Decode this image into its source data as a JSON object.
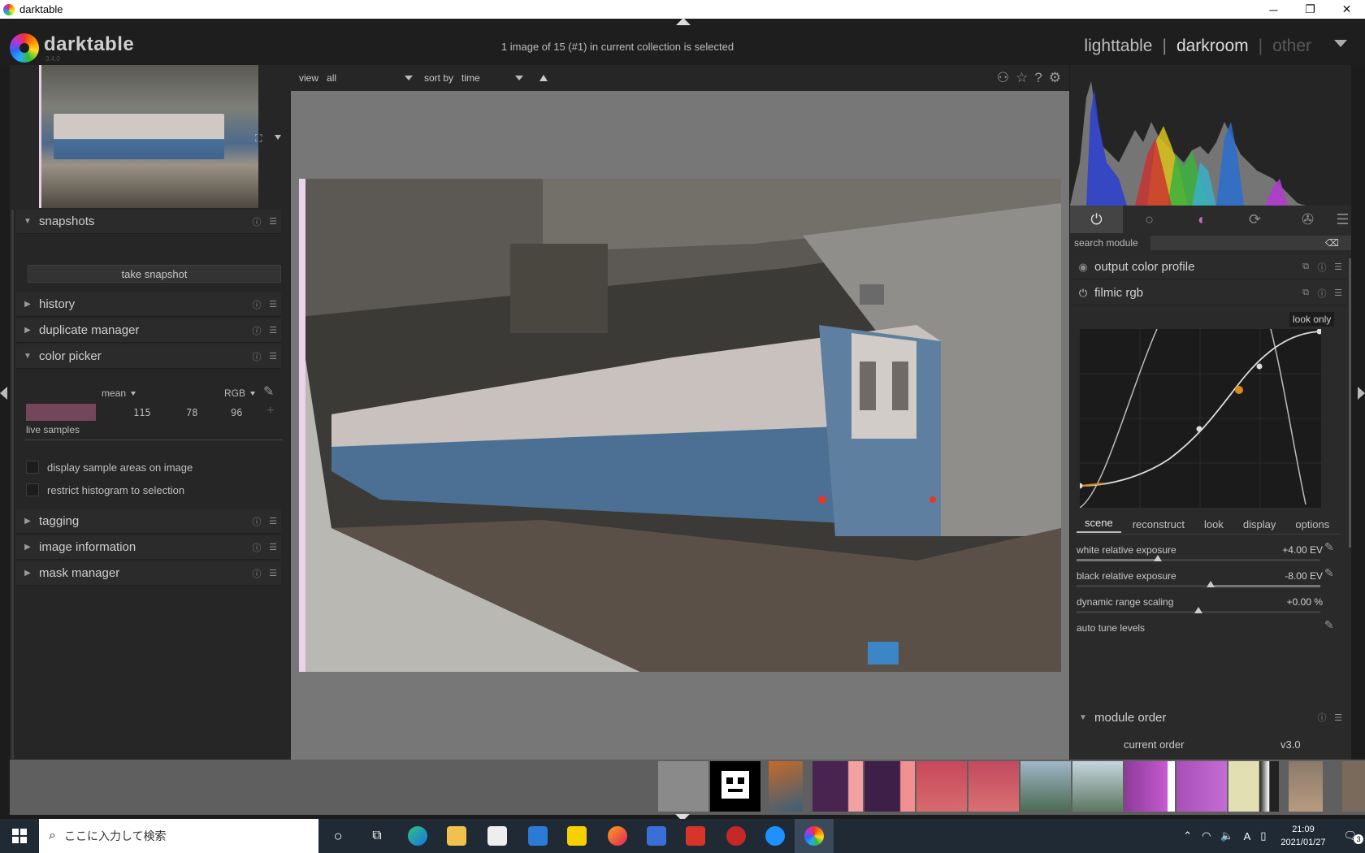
{
  "window": {
    "title": "darktable",
    "buttons": {
      "minimize": "─",
      "maximize": "❐",
      "close": "✕"
    }
  },
  "header": {
    "logo_text": "darktable",
    "version": "3.4.0",
    "collection_message": "1 image of 15 (#1) in current collection is selected",
    "views": {
      "lighttable": "lighttable",
      "sep1": "|",
      "darkroom": "darkroom",
      "sep2": "|",
      "other": "other"
    }
  },
  "left": {
    "modules": {
      "snapshots": "snapshots",
      "history": "history",
      "duplicate_manager": "duplicate manager",
      "color_picker": "color picker",
      "tagging": "tagging",
      "image_information": "image information",
      "mask_manager": "mask manager"
    },
    "take_snapshot": "take snapshot",
    "color_picker": {
      "mode": "mean",
      "space": "RGB",
      "values": [
        "115",
        "78",
        "96"
      ],
      "swatch_color": "#73465a",
      "live_samples": "live samples",
      "display_sample_areas": "display sample areas on image",
      "restrict_histogram": "restrict histogram to selection"
    }
  },
  "center": {
    "view_label": "view",
    "view_value": "all",
    "sort_label": "sort by",
    "sort_value": "time"
  },
  "right": {
    "search_label": "search module",
    "search_placeholder": "",
    "modules": {
      "output_color_profile": "output color profile",
      "filmic_rgb": "filmic rgb",
      "module_order": "module order"
    },
    "look_only": "look only",
    "tabs": {
      "scene": "scene",
      "reconstruct": "reconstruct",
      "look": "look",
      "display": "display",
      "options": "options"
    },
    "sliders": {
      "white_label": "white relative exposure",
      "white_value": "+4.00 EV",
      "black_label": "black relative exposure",
      "black_value": "-8.00 EV",
      "dr_label": "dynamic range scaling",
      "dr_value": "+0.00 %",
      "auto_tune": "auto tune levels"
    },
    "current_order_label": "current order",
    "current_order_value": "v3.0"
  },
  "taskbar": {
    "search_placeholder": "ここに入力して検索",
    "time": "21:09",
    "date": "2021/01/27",
    "ime": "A",
    "notif_count": "3"
  },
  "colors": {
    "accent": "#d98a1c",
    "panel": "#2b2b2b",
    "center_bg": "#777777"
  }
}
